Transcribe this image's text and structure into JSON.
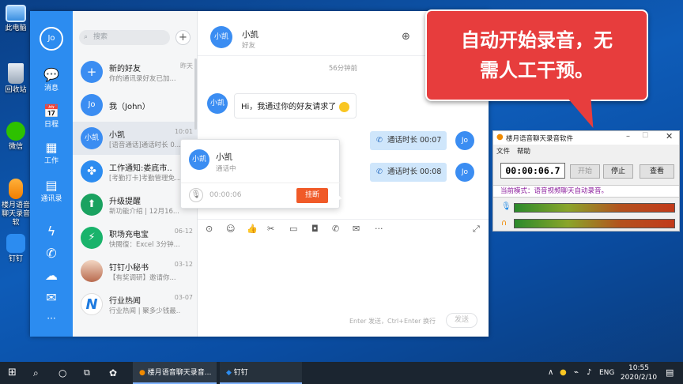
{
  "desktop": {
    "icons": [
      {
        "label": "此电脑"
      },
      {
        "label": "回收站"
      },
      {
        "label": "微信"
      },
      {
        "label": "楼月语音聊天录音软"
      },
      {
        "label": "钉钉"
      }
    ]
  },
  "nav": {
    "avatar": "Jo",
    "items": [
      {
        "label": "消息",
        "icon": "message-icon"
      },
      {
        "label": "日程",
        "icon": "calendar-icon"
      },
      {
        "label": "工作",
        "icon": "work-icon"
      },
      {
        "label": "通讯录",
        "icon": "contacts-icon"
      }
    ],
    "more": "···"
  },
  "list": {
    "search_placeholder": "搜索",
    "plus": "+",
    "items": [
      {
        "name": "新的好友",
        "sub": "你的通讯录好友已加...",
        "time": "昨天",
        "avatar": "+"
      },
      {
        "name": "我（John）",
        "sub": "",
        "time": "",
        "avatar": "Jo"
      },
      {
        "name": "小凯",
        "sub": "[语音通话]通话时长 0...",
        "time": "10:01",
        "avatar": "小凯"
      },
      {
        "name": "工作通知:娄底市...",
        "sub": "[考勤打卡]考勤管理免...",
        "time": "",
        "avatar": ""
      },
      {
        "name": "升级提醒",
        "sub": "新功能介绍 | 12月16...",
        "time": "",
        "avatar": ""
      },
      {
        "name": "职场充电宝",
        "sub": "快閱復：Excel 3分钟...",
        "time": "06-12",
        "avatar": ""
      },
      {
        "name": "钉钉小秘书",
        "sub": "【有奖调研】邀请你...",
        "time": "03-12",
        "avatar": ""
      },
      {
        "name": "行业热闻",
        "sub": "行业热闻 | 聚多少钱最...",
        "time": "03-07",
        "avatar": "N"
      }
    ]
  },
  "chat": {
    "name": "小凯",
    "status": "好友",
    "avatar": "小凯",
    "time_sep": "56分钟前",
    "message": "Hi，我通过你的好友请求了",
    "call1": "通话时长  00:07",
    "call2": "通话时长  00:08",
    "me_avatar": "Jo",
    "input_hint": "Enter 发送，Ctrl+Enter 换行",
    "send": "发送"
  },
  "popup": {
    "name": "小凯",
    "status": "通话中",
    "avatar": "小凯",
    "timer": "00:00:06",
    "hangup": "挂断"
  },
  "callout": {
    "line1": "自动开始录音，无",
    "line2": "需人工干预。"
  },
  "recorder": {
    "title": "楼月语音聊天录音软件",
    "menu": [
      "文件",
      "帮助"
    ],
    "time": "00:00:06.7",
    "btn_start": "开始",
    "btn_stop": "停止",
    "btn_view": "查看",
    "mode": "当前模式：语音视频聊天自动录音。"
  },
  "taskbar": {
    "task1": "楼月语音聊天录音...",
    "task2": "钉钉",
    "lang": "ENG",
    "time": "10:55",
    "date": "2020/2/10"
  }
}
